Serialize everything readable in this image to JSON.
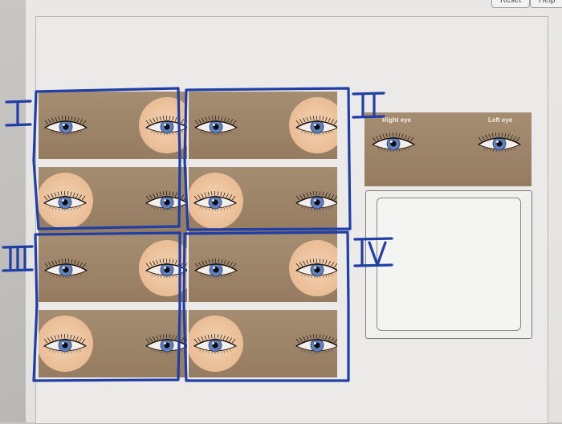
{
  "toolbar": {
    "reset_label": "Reset",
    "help_label": "Help"
  },
  "sample": {
    "right_label": "Right eye",
    "left_label": "Left eye"
  },
  "annotations": [
    "I",
    "II",
    "III",
    "IV"
  ],
  "colors": {
    "skin_panel": "#9e866b",
    "lens_circle": "#ecc49e",
    "iris": "#5f80bc",
    "marker": "#1f3fa6"
  },
  "options": [
    {
      "id": "I",
      "top": {
        "eye": "normal",
        "circle_side": "right"
      },
      "bottom": {
        "circle_side": "left"
      }
    },
    {
      "id": "II",
      "top": {
        "circle_side": "right"
      },
      "bottom": {
        "circle_side": "left"
      }
    },
    {
      "id": "III",
      "top": {
        "circle_side": "right"
      },
      "bottom": {
        "circle_side": "left"
      }
    },
    {
      "id": "IV",
      "top": {
        "circle_side": "right"
      },
      "bottom": {
        "circle_side": "left"
      }
    }
  ]
}
